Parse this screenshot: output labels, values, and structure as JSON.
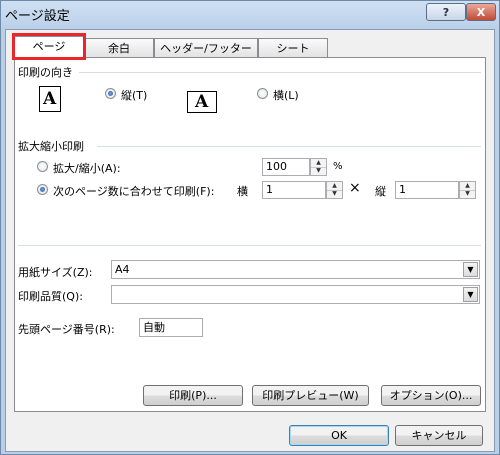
{
  "window": {
    "title": "ページ設定",
    "help_label": "?",
    "close_label": "X"
  },
  "tabs": [
    {
      "label": "ページ",
      "active": true
    },
    {
      "label": "余白",
      "active": false
    },
    {
      "label": "ヘッダー/フッター",
      "active": false
    },
    {
      "label": "シート",
      "active": false
    }
  ],
  "orientation": {
    "section_label": "印刷の向き",
    "portrait_label": "縦(T)",
    "portrait_icon_letter": "A",
    "landscape_label": "横(L)",
    "landscape_icon_letter": "A",
    "selected": "portrait"
  },
  "scaling": {
    "section_label": "拡大縮小印刷",
    "adjust_label": "拡大/縮小(A):",
    "adjust_value": "100",
    "percent_symbol": "%",
    "fit_label": "次のページ数に合わせて印刷(F):",
    "wide_label": "横",
    "wide_value": "1",
    "times_symbol": "×",
    "tall_label": "縦",
    "tall_value": "1",
    "selected": "fit"
  },
  "paper": {
    "size_label": "用紙サイズ(Z):",
    "size_value": "A4",
    "quality_label": "印刷品質(Q):",
    "quality_value": "",
    "first_page_label": "先頭ページ番号(R):",
    "first_page_value": "自動"
  },
  "panel_buttons": {
    "print_label": "印刷(P)...",
    "preview_label": "印刷プレビュー(W)",
    "options_label": "オプション(O)..."
  },
  "dialog_buttons": {
    "ok_label": "OK",
    "cancel_label": "キャンセル"
  },
  "colors": {
    "highlight_box": "#e8262c",
    "title_gradient": "#b9cfe8"
  }
}
